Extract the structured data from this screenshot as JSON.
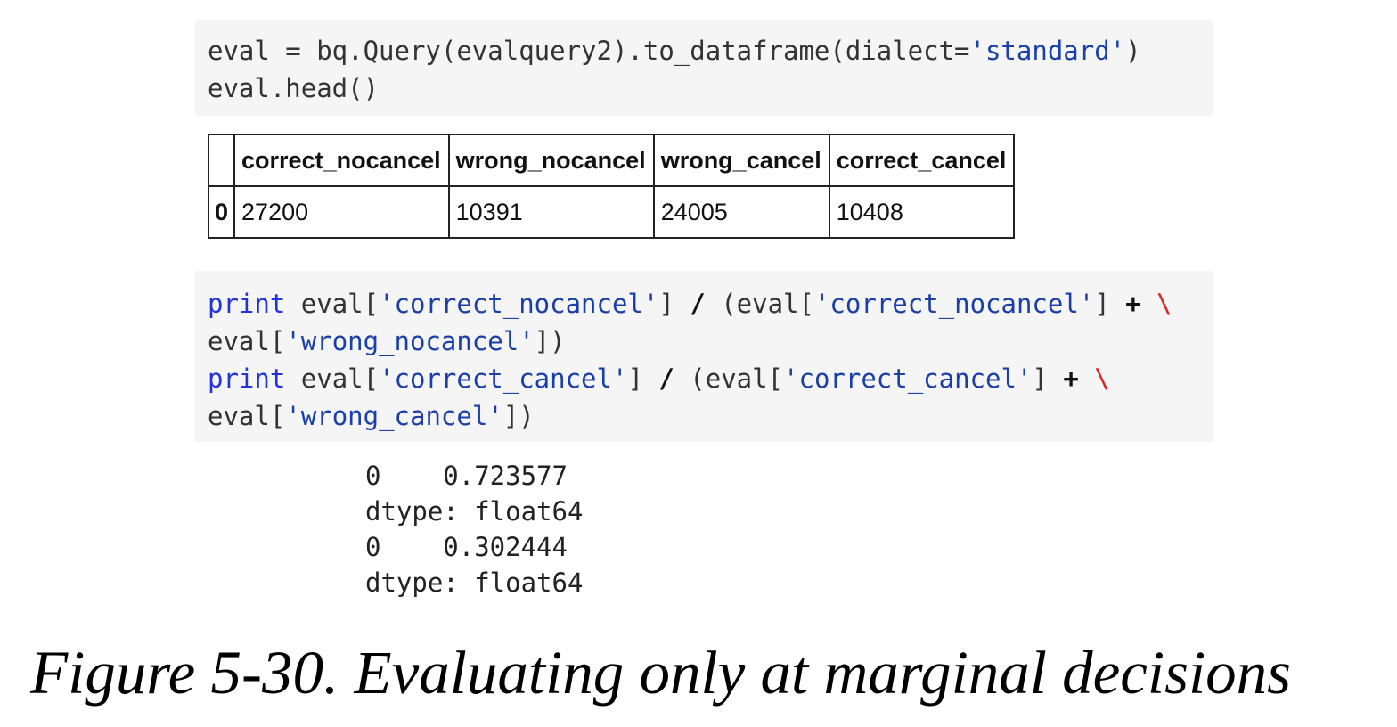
{
  "cell1": {
    "line1": "eval = bq.Query(evalquery2).to_dataframe(dialect=",
    "line1_str": "'standard'",
    "line1_end": ")",
    "line2": "eval.head()"
  },
  "table": {
    "headers": [
      "",
      "correct_nocancel",
      "wrong_nocancel",
      "wrong_cancel",
      "correct_cancel"
    ],
    "rows": [
      {
        "index": "0",
        "values": [
          "27200",
          "10391",
          "24005",
          "10408"
        ]
      }
    ]
  },
  "cell2": {
    "kw": "print",
    "l1a": " eval[",
    "l1s1": "'correct_nocancel'",
    "l1b": "] ",
    "slash": "/",
    "l1c": " (eval[",
    "l1s2": "'correct_nocancel'",
    "l1d": "] ",
    "plus": "+",
    "bs": "\\",
    "l2a": "eval[",
    "l2s": "'wrong_nocancel'",
    "l2b": "])",
    "l3a": " eval[",
    "l3s1": "'correct_cancel'",
    "l3b": "] ",
    "l3c": " (eval[",
    "l3s2": "'correct_cancel'",
    "l3d": "] ",
    "l4a": "eval[",
    "l4s": "'wrong_cancel'",
    "l4b": "])"
  },
  "output": [
    "0    0.723577",
    "dtype: float64",
    "0    0.302444",
    "dtype: float64"
  ],
  "caption": "Figure 5-30. Evaluating only at marginal decisions",
  "colors": {
    "keyword": "#2233dd",
    "string": "#1a3fa8",
    "backslash": "#dd2222",
    "cell_bg": "#f5f5f5"
  }
}
